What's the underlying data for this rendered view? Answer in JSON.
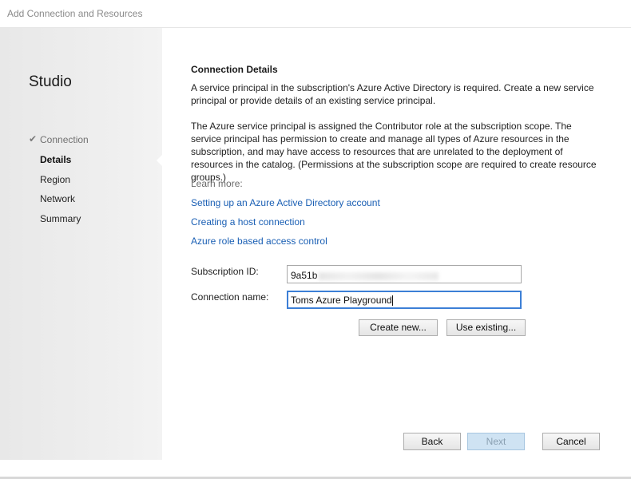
{
  "window": {
    "title": "Add Connection and Resources"
  },
  "sidebar": {
    "title": "Studio",
    "items": [
      {
        "label": "Connection",
        "state": "done",
        "icon": "checkmark-icon"
      },
      {
        "label": "Details",
        "state": "active"
      },
      {
        "label": "Region",
        "state": "pending"
      },
      {
        "label": "Network",
        "state": "pending"
      },
      {
        "label": "Summary",
        "state": "pending"
      }
    ]
  },
  "main": {
    "section_title": "Connection Details",
    "paragraph1": "A service principal in the subscription's Azure Active Directory is required. Create a new service principal or provide details of an existing service principal.",
    "paragraph2": "The Azure service principal is assigned the Contributor role at the subscription scope. The service principal has permission to create and manage all types of Azure resources in the subscription, and may have access to resources that are unrelated to the deployment of resources in the catalog. (Permissions at the subscription scope are required to create resource groups.)",
    "learn_more": "Learn more:",
    "links": [
      "Setting up an Azure Active Directory account",
      "Creating a host connection",
      "Azure role based access control"
    ],
    "subscription_label": "Subscription ID:",
    "subscription_value": "9a51b",
    "connection_label": "Connection name:",
    "connection_value": "Toms Azure Playground",
    "create_new_label": "Create new...",
    "use_existing_label": "Use existing..."
  },
  "footer": {
    "back_label": "Back",
    "next_label": "Next",
    "cancel_label": "Cancel"
  },
  "colors": {
    "link": "#1a5fb4",
    "focus": "#3c7fd6"
  }
}
